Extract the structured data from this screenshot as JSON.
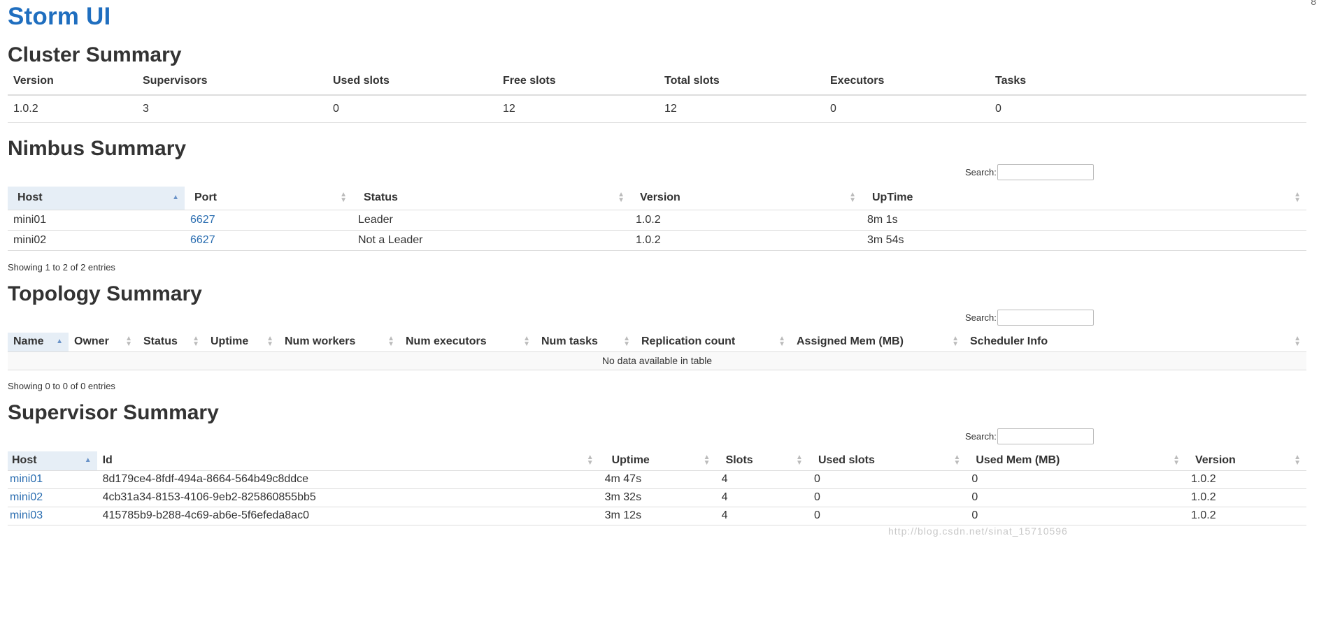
{
  "app_title": "Storm UI",
  "cluster": {
    "title": "Cluster Summary",
    "headers": [
      "Version",
      "Supervisors",
      "Used slots",
      "Free slots",
      "Total slots",
      "Executors",
      "Tasks"
    ],
    "row": [
      "1.0.2",
      "3",
      "0",
      "12",
      "12",
      "0",
      "0"
    ]
  },
  "nimbus": {
    "title": "Nimbus Summary",
    "search_label": "Search:",
    "headers": [
      "Host",
      "Port",
      "Status",
      "Version",
      "UpTime"
    ],
    "rows": [
      [
        "mini01",
        "6627",
        "Leader",
        "1.0.2",
        "8m 1s"
      ],
      [
        "mini02",
        "6627",
        "Not a Leader",
        "1.0.2",
        "3m 54s"
      ]
    ],
    "info": "Showing 1 to 2 of 2 entries"
  },
  "topology": {
    "title": "Topology Summary",
    "search_label": "Search:",
    "headers": [
      "Name",
      "Owner",
      "Status",
      "Uptime",
      "Num workers",
      "Num executors",
      "Num tasks",
      "Replication count",
      "Assigned Mem (MB)",
      "Scheduler Info"
    ],
    "empty_text": "No data available in table",
    "info": "Showing 0 to 0 of 0 entries"
  },
  "supervisor": {
    "title": "Supervisor Summary",
    "search_label": "Search:",
    "headers": [
      "Host",
      "Id",
      "Uptime",
      "Slots",
      "Used slots",
      "Used Mem (MB)",
      "Version"
    ],
    "rows": [
      [
        "mini01",
        "8d179ce4-8fdf-494a-8664-564b49c8ddce",
        "4m 47s",
        "4",
        "0",
        "0",
        "1.0.2"
      ],
      [
        "mini02",
        "4cb31a34-8153-4106-9eb2-825860855bb5",
        "3m 32s",
        "4",
        "0",
        "0",
        "1.0.2"
      ],
      [
        "mini03",
        "415785b9-b288-4c69-ab6e-5f6efeda8ac0",
        "3m 12s",
        "4",
        "0",
        "0",
        "1.0.2"
      ]
    ]
  },
  "watermark": "http://blog.csdn.net/sinat_15710596"
}
